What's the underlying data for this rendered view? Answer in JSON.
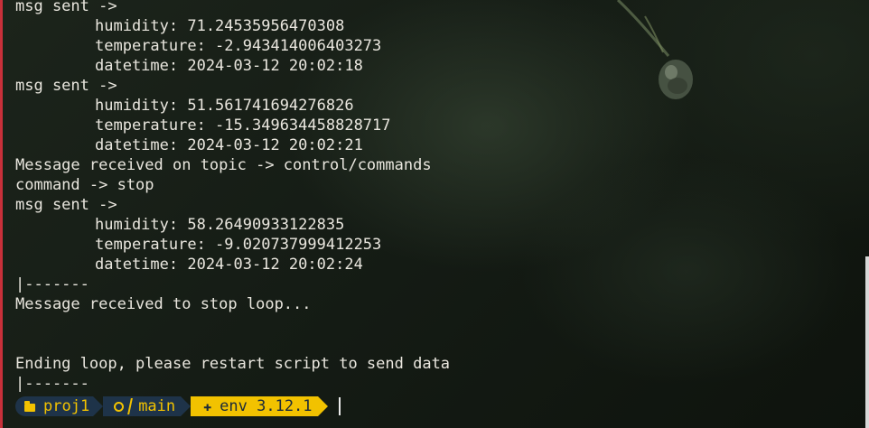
{
  "terminal": {
    "lines": [
      {
        "text": "msg sent ->",
        "indent": false
      },
      {
        "text": "humidity: 71.24535956470308",
        "indent": true
      },
      {
        "text": "temperature: -2.943414006403273",
        "indent": true
      },
      {
        "text": "datetime: 2024-03-12 20:02:18",
        "indent": true
      },
      {
        "text": "msg sent ->",
        "indent": false
      },
      {
        "text": "humidity: 51.561741694276826",
        "indent": true
      },
      {
        "text": "temperature: -15.349634458828717",
        "indent": true
      },
      {
        "text": "datetime: 2024-03-12 20:02:21",
        "indent": true
      },
      {
        "text": "Message received on topic -> control/commands",
        "indent": false
      },
      {
        "text": "command -> stop",
        "indent": false
      },
      {
        "text": "msg sent ->",
        "indent": false
      },
      {
        "text": "humidity: 58.26490933122835",
        "indent": true
      },
      {
        "text": "temperature: -9.020737999412253",
        "indent": true
      },
      {
        "text": "datetime: 2024-03-12 20:02:24",
        "indent": true
      },
      {
        "text": "|-------",
        "indent": false
      },
      {
        "text": "Message received to stop loop...",
        "indent": false
      },
      {
        "text": "",
        "indent": false
      },
      {
        "text": "",
        "indent": false
      },
      {
        "text": "Ending loop, please restart script to send data",
        "indent": false
      },
      {
        "text": "|-------",
        "indent": false
      }
    ]
  },
  "prompt": {
    "directory": "proj1",
    "branch": "main",
    "env": "env 3.12.1",
    "icons": {
      "directory": "folder-icon",
      "git": "github-icon",
      "branch": "branch-icon",
      "env": "python-icon"
    }
  },
  "colors": {
    "text": "#eae7df",
    "segment_dark": "#1e3349",
    "segment_yellow": "#f2c200",
    "left_accent": "#c8303a"
  }
}
